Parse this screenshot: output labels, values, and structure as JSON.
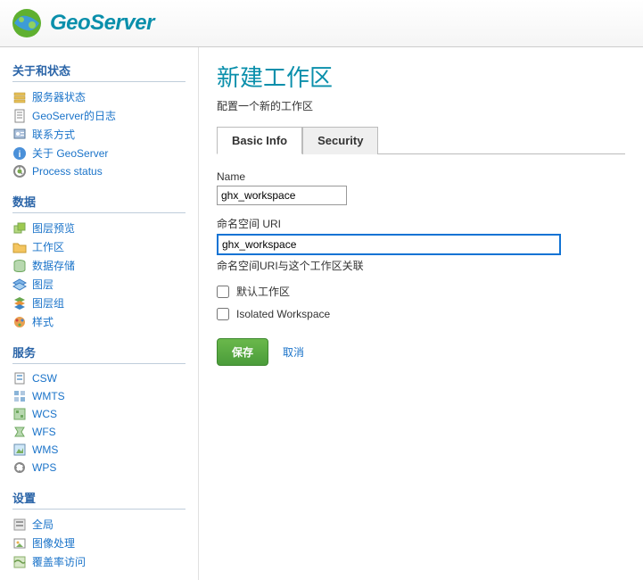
{
  "brand": "GeoServer",
  "sidebar": {
    "sections": [
      {
        "title": "关于和状态",
        "items": [
          {
            "label": "服务器状态",
            "icon": "server-status-icon"
          },
          {
            "label": "GeoServer的日志",
            "icon": "log-icon"
          },
          {
            "label": "联系方式",
            "icon": "contact-icon"
          },
          {
            "label": "关于 GeoServer",
            "icon": "about-icon"
          },
          {
            "label": "Process status",
            "icon": "process-icon"
          }
        ]
      },
      {
        "title": "数据",
        "items": [
          {
            "label": "图层预览",
            "icon": "layer-preview-icon"
          },
          {
            "label": "工作区",
            "icon": "workspace-icon"
          },
          {
            "label": "数据存储",
            "icon": "datastore-icon"
          },
          {
            "label": "图层",
            "icon": "layers-icon"
          },
          {
            "label": "图层组",
            "icon": "layergroup-icon"
          },
          {
            "label": "样式",
            "icon": "style-icon"
          }
        ]
      },
      {
        "title": "服务",
        "items": [
          {
            "label": "CSW",
            "icon": "csw-icon"
          },
          {
            "label": "WMTS",
            "icon": "wmts-icon"
          },
          {
            "label": "WCS",
            "icon": "wcs-icon"
          },
          {
            "label": "WFS",
            "icon": "wfs-icon"
          },
          {
            "label": "WMS",
            "icon": "wms-icon"
          },
          {
            "label": "WPS",
            "icon": "wps-icon"
          }
        ]
      },
      {
        "title": "设置",
        "items": [
          {
            "label": "全局",
            "icon": "global-icon"
          },
          {
            "label": "图像处理",
            "icon": "image-icon"
          },
          {
            "label": "覆盖率访问",
            "icon": "coverage-icon"
          }
        ]
      }
    ]
  },
  "main": {
    "title": "新建工作区",
    "subtitle": "配置一个新的工作区",
    "tabs": [
      {
        "label": "Basic Info",
        "active": true
      },
      {
        "label": "Security",
        "active": false
      }
    ],
    "form": {
      "name_label": "Name",
      "name_value": "ghx_workspace",
      "uri_label": "命名空间 URI",
      "uri_value": "ghx_workspace",
      "uri_help": "命名空间URI与这个工作区关联",
      "default_label": "默认工作区",
      "isolated_label": "Isolated Workspace",
      "save": "保存",
      "cancel": "取消"
    }
  }
}
